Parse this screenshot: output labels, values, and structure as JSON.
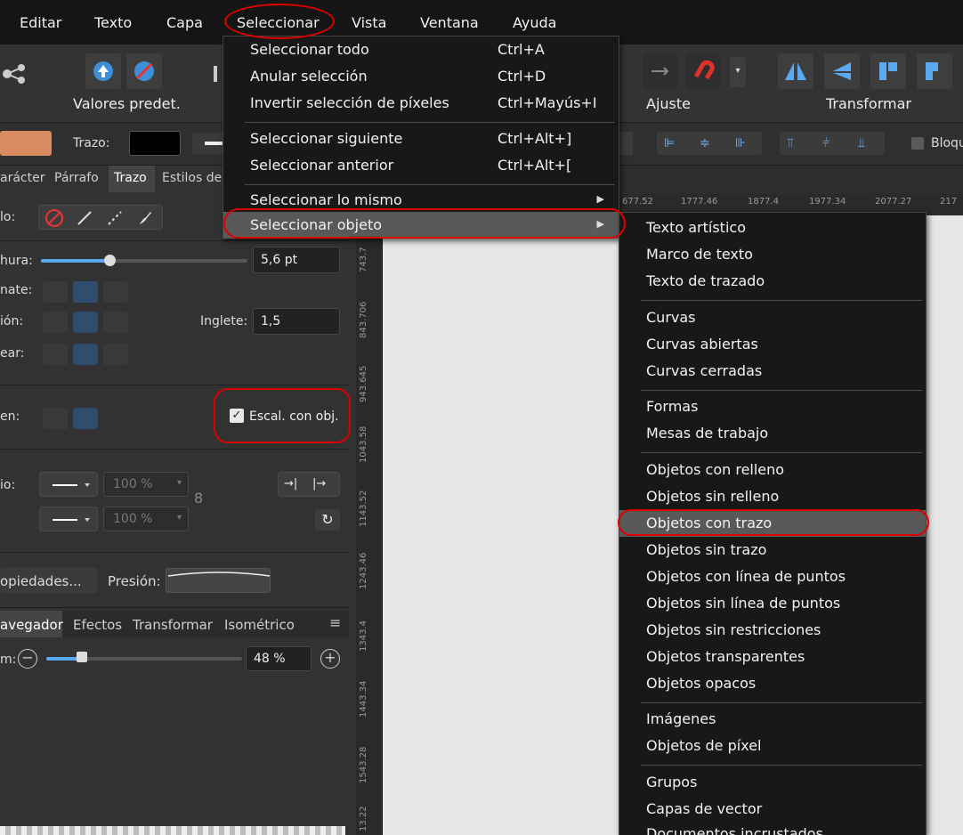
{
  "menubar": {
    "items": [
      "Editar",
      "Texto",
      "Capa",
      "Seleccionar",
      "Vista",
      "Ventana",
      "Ayuda"
    ]
  },
  "toolbar": {
    "defaults_label": "Valores predet.",
    "snap_label": "Ajuste",
    "transform_label": "Transformar"
  },
  "contextbar": {
    "stroke_label": "Trazo:",
    "lock_label": "Bloqu"
  },
  "panel": {
    "tabs": [
      "arácter",
      "Párrafo",
      "Trazo",
      "Estilos de"
    ],
    "style_label": "lo:",
    "width_label": "hura:",
    "width_value": "5,6 pt",
    "cap_label": "nate:",
    "join_label": "ión:",
    "miter_label": "Inglete:",
    "miter_value": "1,5",
    "align_label": "ear:",
    "order_label": "en:",
    "scale_with_object": "Escal. con obj.",
    "arrows_label": "io:",
    "arrow_start_pct": "100 %",
    "arrow_end_pct": "100 %",
    "properties_button": "opiedades...",
    "pressure_label": "Presión:"
  },
  "nav": {
    "tabs": [
      "avegador",
      "Efectos",
      "Transformar",
      "Isométrico"
    ],
    "zoom_label": "m:",
    "zoom_value": "48 %"
  },
  "ruler": {
    "vertical": [
      "743.7",
      "843.706",
      "943.645",
      "1043.58",
      "1143.52",
      "1243.46",
      "1343.4",
      "1443.34",
      "1543.28",
      "13.22"
    ],
    "horizontal": [
      "677.52",
      "1777.46",
      "1877.4",
      "1977.34",
      "2077.27",
      "217"
    ]
  },
  "select_menu": {
    "items": [
      {
        "label": "Seleccionar todo",
        "shortcut": "Ctrl+A"
      },
      {
        "label": "Anular selección",
        "shortcut": "Ctrl+D"
      },
      {
        "label": "Invertir selección de píxeles",
        "shortcut": "Ctrl+Mayús+I"
      },
      {
        "label": "Seleccionar siguiente",
        "shortcut": "Ctrl+Alt+]"
      },
      {
        "label": "Seleccionar anterior",
        "shortcut": "Ctrl+Alt+["
      },
      {
        "label": "Seleccionar lo mismo",
        "shortcut": ""
      },
      {
        "label": "Seleccionar objeto",
        "shortcut": ""
      }
    ]
  },
  "object_submenu": {
    "items": [
      "Texto artístico",
      "Marco de texto",
      "Texto de trazado",
      "Curvas",
      "Curvas abiertas",
      "Curvas cerradas",
      "Formas",
      "Mesas de trabajo",
      "Objetos con relleno",
      "Objetos sin relleno",
      "Objetos con trazo",
      "Objetos sin trazo",
      "Objetos con línea de puntos",
      "Objetos sin línea de puntos",
      "Objetos sin restricciones",
      "Objetos transparentes",
      "Objetos opacos",
      "Imágenes",
      "Objetos de píxel",
      "Grupos",
      "Capas de vector",
      "Documentos incrustados"
    ]
  },
  "colors": {
    "fill_swatch": "#d98c60",
    "stroke_swatch": "#000000",
    "highlight": "#595959",
    "annotation_red": "#dd0000"
  }
}
